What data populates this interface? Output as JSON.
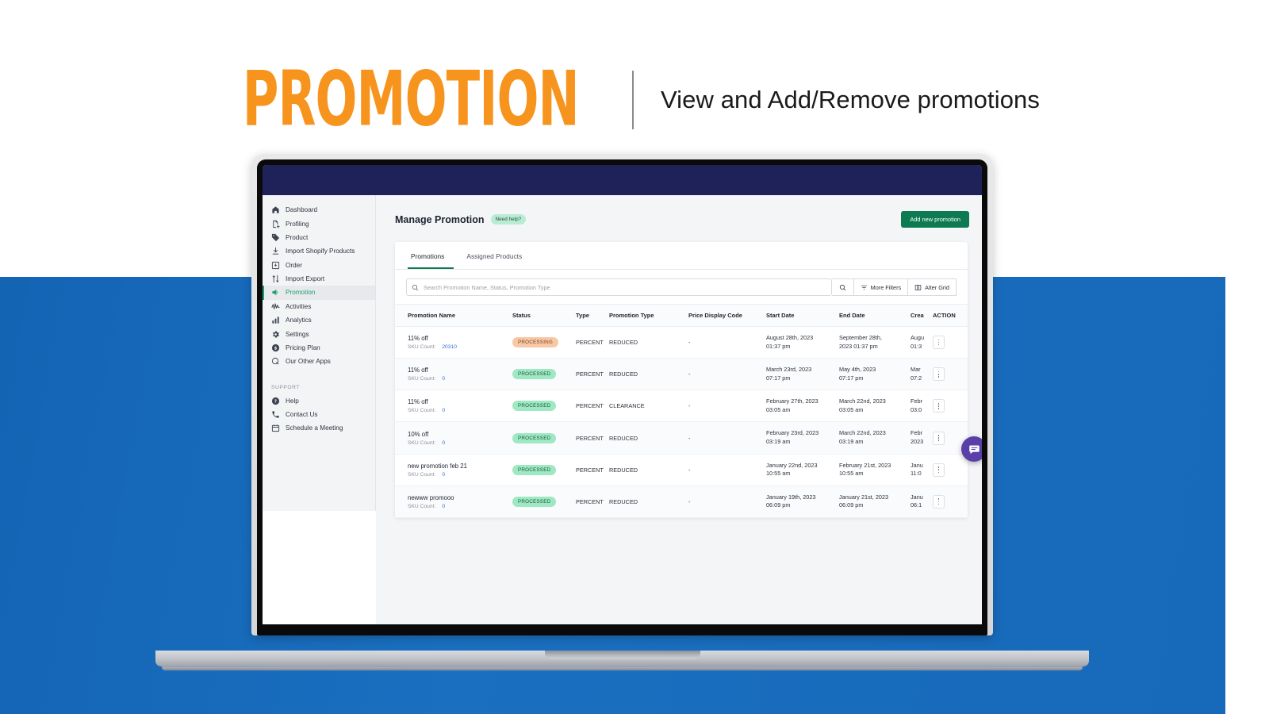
{
  "header": {
    "title_word": "PROMOTION",
    "subtitle": "View and Add/Remove promotions",
    "accent_orange": "#F7941E"
  },
  "sidebar": {
    "items": [
      {
        "label": "Dashboard",
        "icon": "home-icon",
        "active": false
      },
      {
        "label": "Profiling",
        "icon": "profile-add-icon",
        "active": false
      },
      {
        "label": "Product",
        "icon": "tag-icon",
        "active": false
      },
      {
        "label": "Import Shopify Products",
        "icon": "download-icon",
        "active": false
      },
      {
        "label": "Order",
        "icon": "inbox-download-icon",
        "active": false
      },
      {
        "label": "Import Export",
        "icon": "up-down-arrows-icon",
        "active": false
      },
      {
        "label": "Promotion",
        "icon": "megaphone-icon",
        "active": true
      },
      {
        "label": "Activities",
        "icon": "pulse-icon",
        "active": false
      },
      {
        "label": "Analytics",
        "icon": "bar-chart-icon",
        "active": false
      },
      {
        "label": "Settings",
        "icon": "gear-icon",
        "active": false
      },
      {
        "label": "Pricing Plan",
        "icon": "dollar-circle-icon",
        "active": false
      },
      {
        "label": "Our Other Apps",
        "icon": "apps-circle-icon",
        "active": false
      }
    ],
    "support_label": "SUPPORT",
    "support_items": [
      {
        "label": "Help",
        "icon": "question-circle-icon"
      },
      {
        "label": "Contact Us",
        "icon": "phone-icon"
      },
      {
        "label": "Schedule a Meeting",
        "icon": "calendar-icon"
      }
    ],
    "active_color": "#1a9f6a"
  },
  "page": {
    "title": "Manage Promotion",
    "need_help_badge": "Need help?",
    "add_button": "Add new promotion",
    "add_button_color": "#0e7a52"
  },
  "tabs": [
    {
      "label": "Promotions",
      "active": true
    },
    {
      "label": "Assigned Products",
      "active": false
    }
  ],
  "search": {
    "placeholder": "Search Promotion Name, Status, Promotion Type",
    "value": "",
    "more_filters": "More Filters",
    "alter_grid": "Alter Grid"
  },
  "table": {
    "columns": [
      "Promotion Name",
      "Status",
      "Type",
      "Promotion Type",
      "Price Display Code",
      "Start Date",
      "End Date",
      "Crea",
      "ACTION"
    ],
    "sku_label": "SKU Count:",
    "rows": [
      {
        "name": "11% off",
        "sku_count": "20310",
        "status": "PROCESSING",
        "status_kind": "processing",
        "type": "PERCENT",
        "promo_type": "REDUCED",
        "price_display_code": "-",
        "start_date": "August 28th, 2023",
        "start_time": "01:37 pm",
        "end_date": "September 28th,",
        "end_time": "2023 01:37 pm",
        "created_date": "Augu",
        "created_time": "01:3"
      },
      {
        "name": "11% off",
        "sku_count": "0",
        "status": "PROCESSED",
        "status_kind": "processed",
        "type": "PERCENT",
        "promo_type": "REDUCED",
        "price_display_code": "-",
        "start_date": "March 23rd, 2023",
        "start_time": "07:17 pm",
        "end_date": "May 4th, 2023",
        "end_time": "07:17 pm",
        "created_date": "Mar",
        "created_time": "07:2"
      },
      {
        "name": "11% off",
        "sku_count": "0",
        "status": "PROCESSED",
        "status_kind": "processed",
        "type": "PERCENT",
        "promo_type": "CLEARANCE",
        "price_display_code": "-",
        "start_date": "February 27th, 2023",
        "start_time": "03:05 am",
        "end_date": "March 22nd, 2023",
        "end_time": "03:05 am",
        "created_date": "Febr",
        "created_time": "03:0"
      },
      {
        "name": "10% off",
        "sku_count": "0",
        "status": "PROCESSED",
        "status_kind": "processed",
        "type": "PERCENT",
        "promo_type": "REDUCED",
        "price_display_code": "-",
        "start_date": "February 23rd, 2023",
        "start_time": "03:19 am",
        "end_date": "March 22nd, 2023",
        "end_time": "03:19 am",
        "created_date": "Febr",
        "created_time": "2023"
      },
      {
        "name": "new promotion feb 21",
        "sku_count": "0",
        "status": "PROCESSED",
        "status_kind": "processed",
        "type": "PERCENT",
        "promo_type": "REDUCED",
        "price_display_code": "-",
        "start_date": "January 22nd, 2023",
        "start_time": "10:55 am",
        "end_date": "February 21st, 2023",
        "end_time": "10:55 am",
        "created_date": "Janu",
        "created_time": "11:0"
      },
      {
        "name": "newww promooo",
        "sku_count": "0",
        "status": "PROCESSED",
        "status_kind": "processed",
        "type": "PERCENT",
        "promo_type": "REDUCED",
        "price_display_code": "-",
        "start_date": "January 19th, 2023",
        "start_time": "06:09 pm",
        "end_date": "January 21st, 2023",
        "end_time": "06:09 pm",
        "created_date": "Janu",
        "created_time": "06:1"
      }
    ]
  },
  "chat": {
    "icon": "chat-message-icon",
    "color": "#5b3fa8"
  }
}
